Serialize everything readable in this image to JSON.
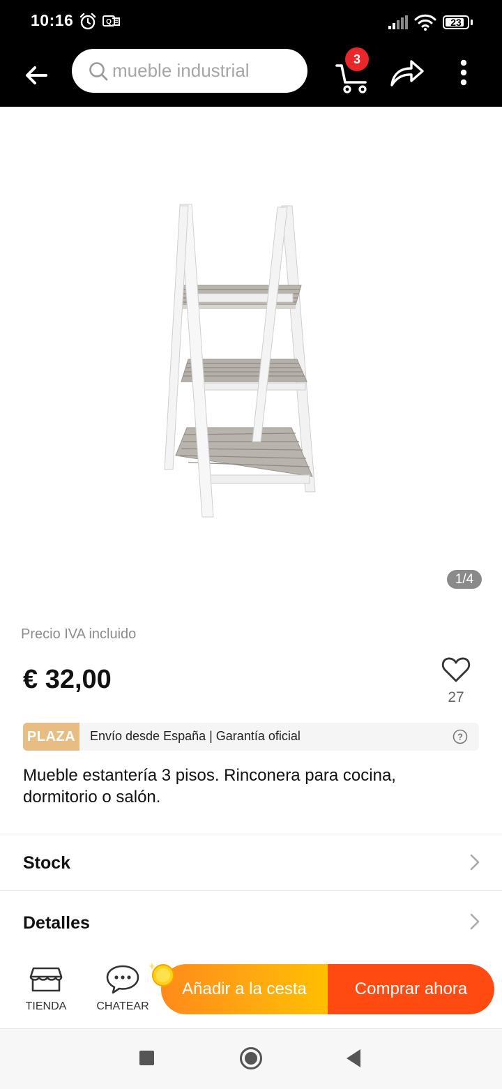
{
  "status_bar": {
    "time": "10:16",
    "battery": "23",
    "icons": [
      "alarm-icon",
      "notification-app-icon",
      "signal-icon",
      "wifi-icon",
      "battery-icon"
    ]
  },
  "header": {
    "search_placeholder": "mueble industrial",
    "cart_count": "3",
    "icons": [
      "back-arrow-icon",
      "search-icon",
      "cart-icon",
      "share-icon",
      "more-vertical-icon"
    ]
  },
  "gallery": {
    "pager": "1/4",
    "image": "white wooden three-tier ladder shelf"
  },
  "product": {
    "tax_note": "Precio IVA incluido",
    "price": "€ 32,00",
    "favorites": "27",
    "plaza_badge": "PLAZA",
    "plaza_text": "Envío desde España | Garantía oficial",
    "title": "Mueble estantería 3 pisos. Rinconera para cocina, dormitorio o salón."
  },
  "sections": [
    {
      "label": "Stock"
    },
    {
      "label": "Detalles"
    }
  ],
  "action_bar": {
    "store_label": "TIENDA",
    "chat_label": "CHATEAR",
    "add_to_cart": "Añadir a la cesta",
    "buy_now": "Comprar ahora"
  },
  "colors": {
    "accent_orange": "#ff8a1a",
    "buy_red": "#ff4b12",
    "badge_red": "#e8262c",
    "plaza_gold": "#e8bd83"
  }
}
